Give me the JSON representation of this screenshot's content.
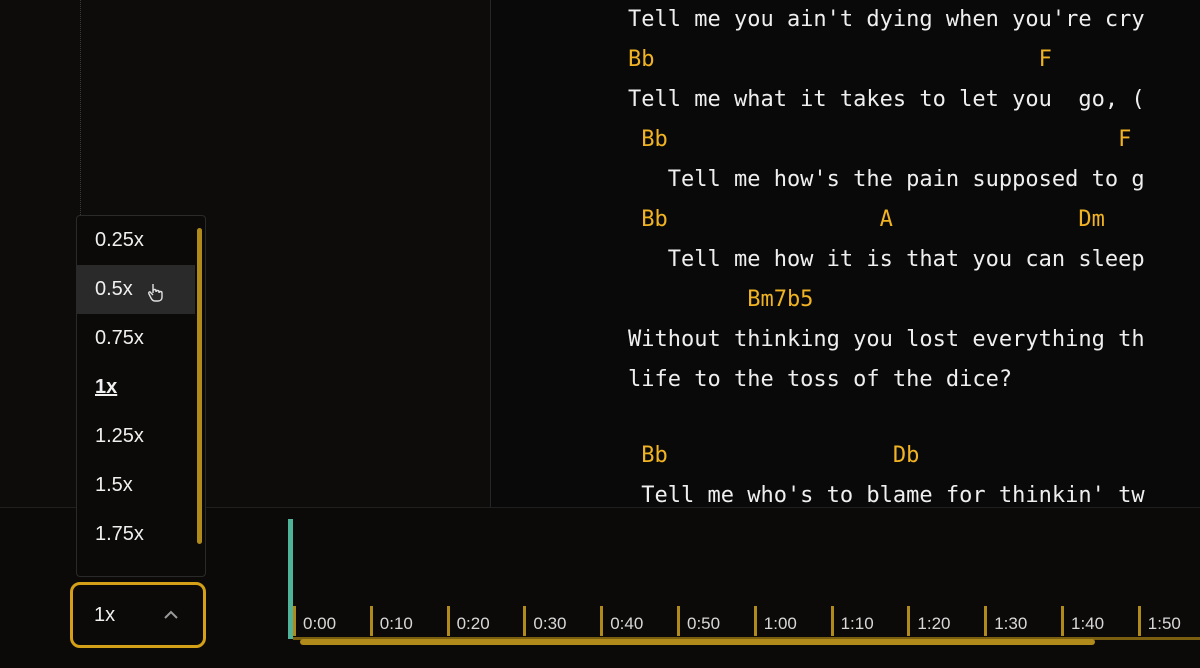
{
  "song": {
    "lines": [
      {
        "type": "lyric",
        "text": "Tell me you ain't dying when you're cry"
      },
      {
        "type": "chord",
        "text": "Bb                             F"
      },
      {
        "type": "lyric",
        "text": "Tell me what it takes to let you  go, ("
      },
      {
        "type": "chord",
        "text": " Bb                                  F"
      },
      {
        "type": "lyric",
        "text": "   Tell me how's the pain supposed to g"
      },
      {
        "type": "chord",
        "text": " Bb                A              Dm"
      },
      {
        "type": "lyric",
        "text": "   Tell me how it is that you can sleep"
      },
      {
        "type": "chord",
        "text": "         Bm7b5"
      },
      {
        "type": "lyric",
        "text": "Without thinking you lost everything th"
      },
      {
        "type": "lyric",
        "text": "life to the toss of the dice?"
      },
      {
        "type": "chord",
        "text": " Bb                 Db"
      },
      {
        "type": "lyric",
        "text": " Tell me who's to blame for thinkin' tw"
      }
    ]
  },
  "speed_menu": {
    "options": [
      "0.25x",
      "0.5x",
      "0.75x",
      "1x",
      "1.25x",
      "1.5x",
      "1.75x"
    ],
    "hovered": "0.5x",
    "selected": "1x"
  },
  "speed_button": {
    "value": "1x",
    "icon": "chevron-up-icon"
  },
  "timeline": {
    "ticks": [
      "0:00",
      "0:10",
      "0:20",
      "0:30",
      "0:40",
      "0:50",
      "1:00",
      "1:10",
      "1:20",
      "1:30",
      "1:40",
      "1:50"
    ]
  },
  "colors": {
    "chord": "#f0b323",
    "accent": "#d4a017",
    "playhead": "#4fb39a"
  }
}
